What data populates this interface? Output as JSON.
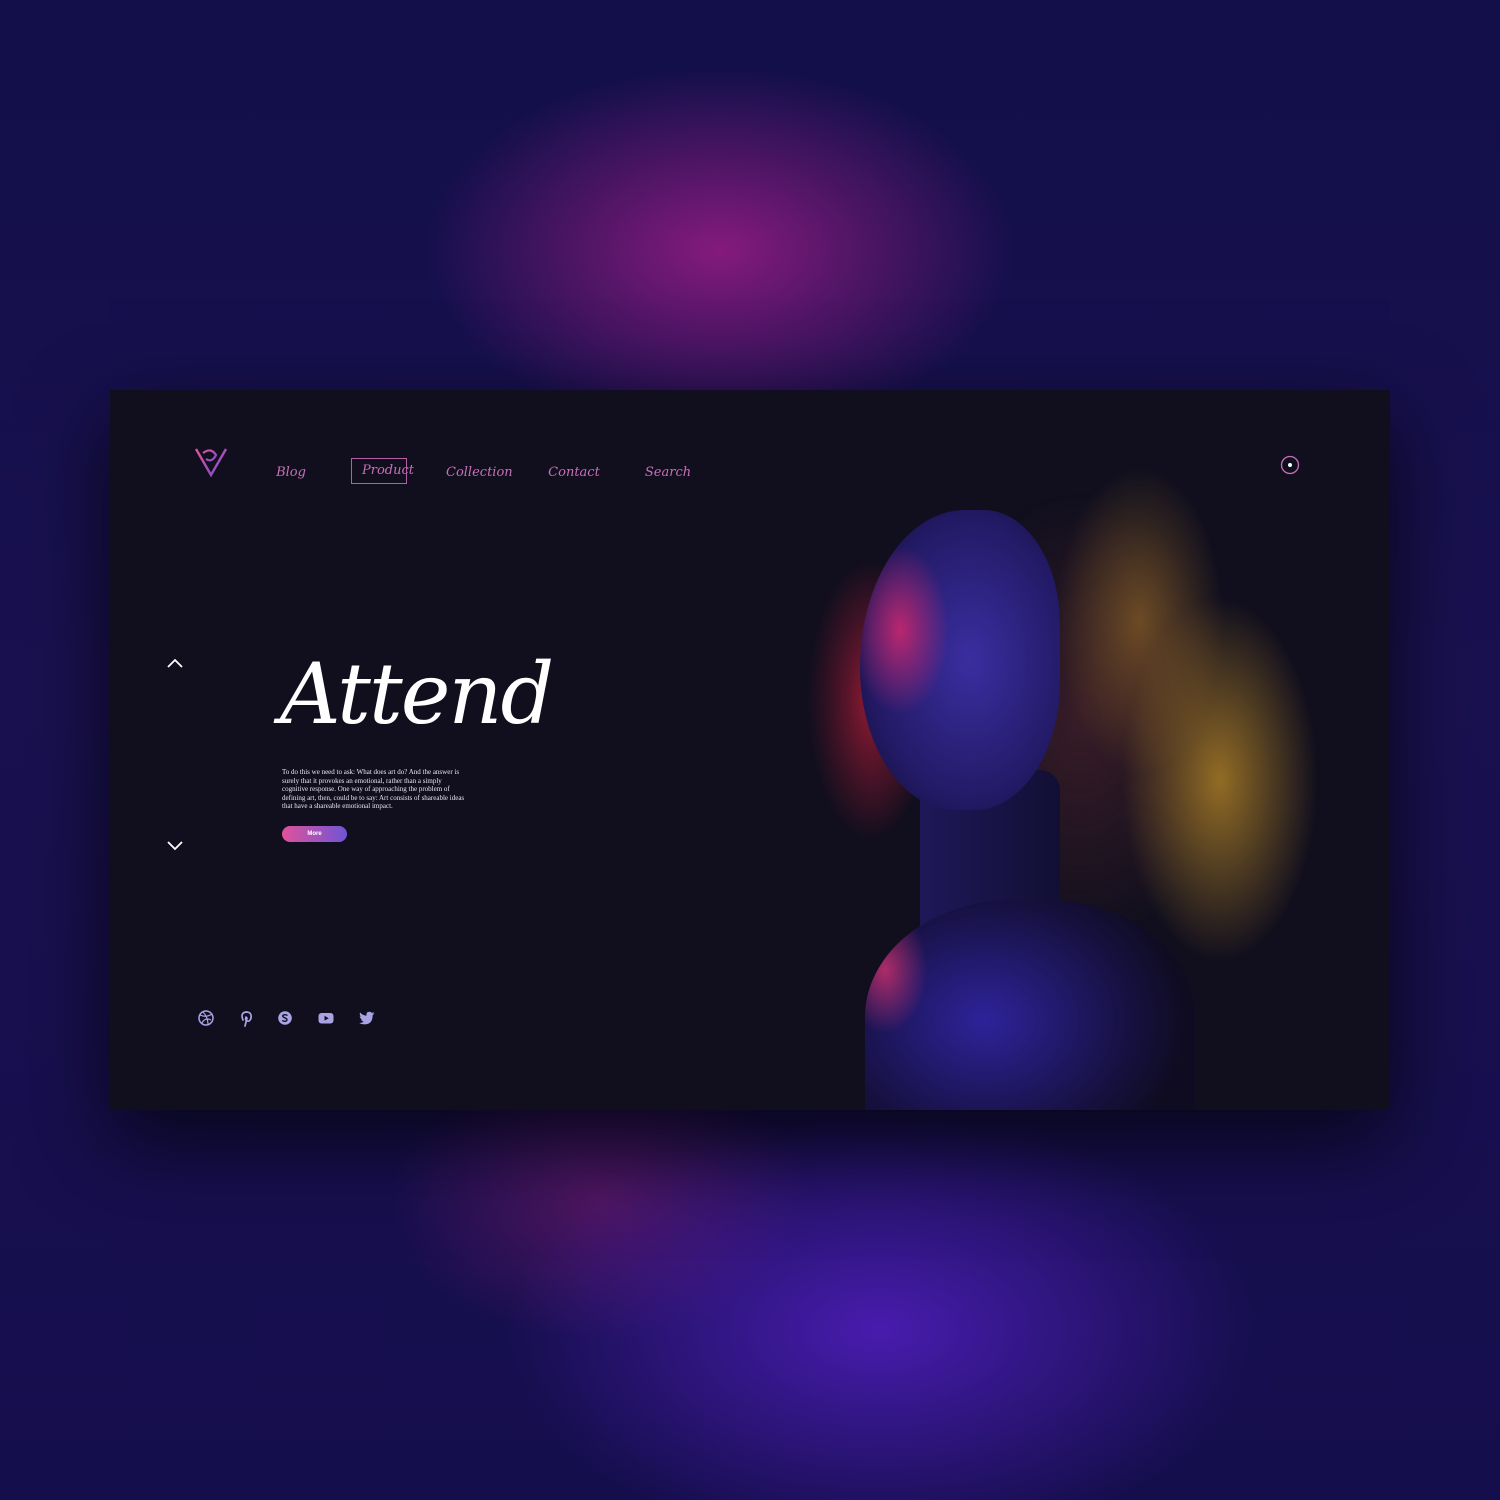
{
  "colors": {
    "accent_pink": "#c76fb8",
    "button_gradient_start": "#e0529a",
    "button_gradient_end": "#6f55d6",
    "card_background": "#110f1e",
    "social_icon": "#a9a3e6"
  },
  "header": {
    "logo_icon": "v-logo-icon",
    "nav": [
      {
        "label": "Blog"
      },
      {
        "label": "Product",
        "active": true
      },
      {
        "label": "Collection"
      },
      {
        "label": "Contact"
      },
      {
        "label": "Search"
      }
    ],
    "user_icon": "user-circle-icon"
  },
  "slider": {
    "up_icon": "chevron-up-icon",
    "down_icon": "chevron-down-icon"
  },
  "hero": {
    "title": "Attend",
    "description": "To do this we need to ask: What does art do? And the answer is surely that it provokes an emotional, rather than a simply cognitive response. One way of approaching the problem of defining art, then, could be to say: Art consists of shareable ideas that have a shareable emotional impact.",
    "button_label": "More"
  },
  "social": [
    "dribbble-icon",
    "pinterest-icon",
    "skype-icon",
    "youtube-icon",
    "twitter-icon"
  ]
}
